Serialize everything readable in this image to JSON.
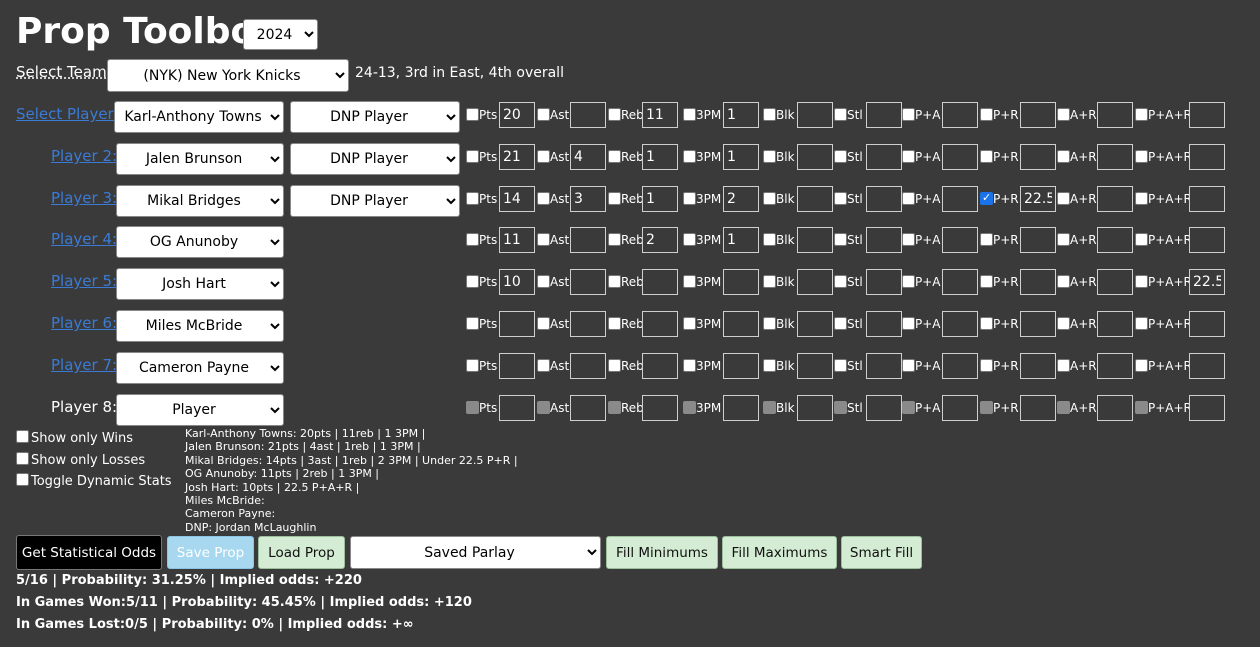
{
  "app": {
    "title": "Prop Toolbox",
    "year": "2024"
  },
  "team": {
    "label": "Select Team:",
    "selected": "(NYK) New York Knicks",
    "record": "24-13, 3rd in East, 4th overall"
  },
  "stat_labels": [
    "Pts",
    "Ast",
    "Reb",
    "3PM",
    "Blk",
    "Stl",
    "P+A",
    "P+R",
    "A+R",
    "P+A+R"
  ],
  "dnp_label": "DNP Player",
  "players": [
    {
      "label": "Select Player:",
      "name": "Karl-Anthony Towns",
      "dnp": true,
      "style": "link",
      "disabled": false,
      "values": [
        "20",
        "",
        "11",
        "1",
        "",
        "",
        "",
        "",
        "",
        ""
      ],
      "checked": []
    },
    {
      "label": "Player 2:",
      "name": "Jalen Brunson",
      "dnp": true,
      "style": "link",
      "disabled": false,
      "values": [
        "21",
        "4",
        "1",
        "1",
        "",
        "",
        "",
        "",
        "",
        ""
      ],
      "checked": []
    },
    {
      "label": "Player 3:",
      "name": "Mikal Bridges",
      "dnp": true,
      "style": "link",
      "disabled": false,
      "values": [
        "14",
        "3",
        "1",
        "2",
        "",
        "",
        "",
        "22.5",
        "",
        ""
      ],
      "checked": [
        7
      ]
    },
    {
      "label": "Player 4:",
      "name": "OG Anunoby",
      "dnp": false,
      "style": "link",
      "disabled": false,
      "values": [
        "11",
        "",
        "2",
        "1",
        "",
        "",
        "",
        "",
        "",
        ""
      ],
      "checked": []
    },
    {
      "label": "Player 5:",
      "name": "Josh Hart",
      "dnp": false,
      "style": "link",
      "disabled": false,
      "values": [
        "10",
        "",
        "",
        "",
        "",
        "",
        "",
        "",
        "",
        "22.5"
      ],
      "checked": []
    },
    {
      "label": "Player 6:",
      "name": "Miles McBride",
      "dnp": false,
      "style": "link",
      "disabled": false,
      "values": [
        "",
        "",
        "",
        "",
        "",
        "",
        "",
        "",
        "",
        ""
      ],
      "checked": []
    },
    {
      "label": "Player 7:",
      "name": "Cameron Payne",
      "dnp": false,
      "style": "link",
      "disabled": false,
      "values": [
        "",
        "",
        "",
        "",
        "",
        "",
        "",
        "",
        "",
        ""
      ],
      "checked": []
    },
    {
      "label": "Player 8:",
      "name": "Player",
      "dnp": false,
      "style": "plain",
      "disabled": true,
      "values": [
        "",
        "",
        "",
        "",
        "",
        "",
        "",
        "",
        "",
        ""
      ],
      "checked": []
    }
  ],
  "options": {
    "show_wins": "Show only Wins",
    "show_losses": "Show only Losses",
    "dynamic_stats": "Toggle Dynamic Stats"
  },
  "summary_lines": [
    "Karl-Anthony Towns: 20pts | 11reb | 1 3PM |",
    "Jalen Brunson: 21pts | 4ast | 1reb | 1 3PM |",
    "Mikal Bridges: 14pts | 3ast | 1reb | 2 3PM | Under 22.5 P+R |",
    "OG Anunoby: 11pts | 2reb | 1 3PM |",
    "Josh Hart: 10pts | 22.5 P+A+R |",
    "Miles McBride:",
    "Cameron Payne:",
    "DNP: Jordan McLaughlin"
  ],
  "buttons": {
    "statistical_odds": "Get Statistical Odds",
    "save_prop": "Save Prop",
    "load_prop": "Load Prop",
    "saved_parlay": "Saved Parlay",
    "fill_minimums": "Fill Minimums",
    "fill_maximums": "Fill Maximums",
    "smart_fill": "Smart Fill"
  },
  "results": {
    "overall": "5/16 | Probability: 31.25% | Implied odds: +220",
    "won": "In Games Won:5/11 | Probability: 45.45% | Implied odds: +120",
    "lost": "In Games Lost:0/5 | Probability: 0% | Implied odds: +∞"
  },
  "colors": {
    "background": "#3a3a3a",
    "link": "#3b7bd6",
    "button_light": "#d4ecd4",
    "save_button": "#a8d8f0"
  }
}
